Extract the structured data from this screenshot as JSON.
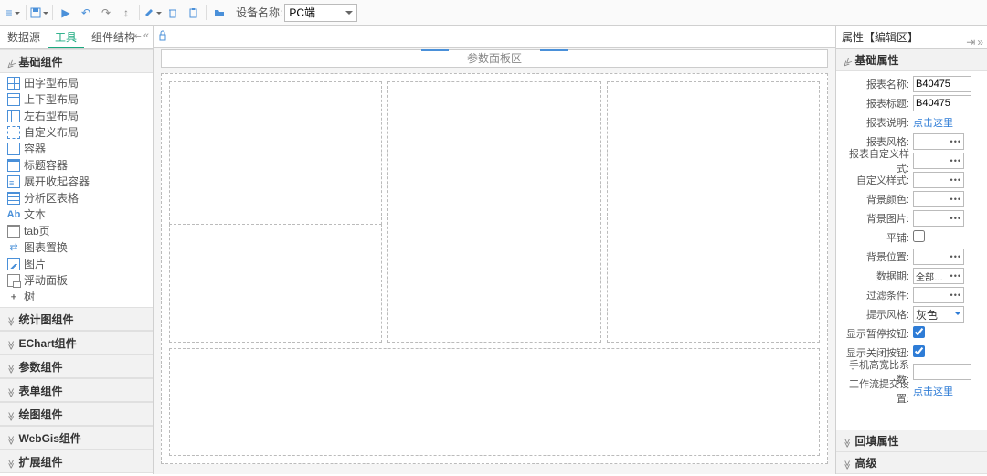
{
  "toolbar": {
    "device_label": "设备名称:",
    "device_value": "PC端"
  },
  "left": {
    "tabs": [
      "数据源",
      "工具",
      "组件结构"
    ],
    "active_tab": 1,
    "groups": [
      {
        "title": "基础组件",
        "open": true,
        "items": [
          {
            "icon": "grid",
            "label": "田字型布局"
          },
          {
            "icon": "top",
            "label": "上下型布局"
          },
          {
            "icon": "lr",
            "label": "左右型布局"
          },
          {
            "icon": "dash",
            "label": "自定义布局"
          },
          {
            "icon": "rect",
            "label": "容器"
          },
          {
            "icon": "title",
            "label": "标题容器"
          },
          {
            "icon": "expand",
            "label": "展开收起容器"
          },
          {
            "icon": "table",
            "label": "分析区表格"
          },
          {
            "icon": "ab",
            "label": "文本"
          },
          {
            "icon": "tab",
            "label": "tab页"
          },
          {
            "icon": "swap",
            "label": "图表置换"
          },
          {
            "icon": "img",
            "label": "图片"
          },
          {
            "icon": "float",
            "label": "浮动面板"
          },
          {
            "icon": "tree",
            "label": "树"
          }
        ]
      },
      {
        "title": "统计图组件",
        "open": false
      },
      {
        "title": "EChart组件",
        "open": false
      },
      {
        "title": "参数组件",
        "open": false
      },
      {
        "title": "表单组件",
        "open": false
      },
      {
        "title": "绘图组件",
        "open": false
      },
      {
        "title": "WebGis组件",
        "open": false
      },
      {
        "title": "扩展组件",
        "open": false
      }
    ]
  },
  "center": {
    "param_panel_label": "参数面板区"
  },
  "right": {
    "title": "属性【编辑区】",
    "sections": {
      "basic": "基础属性",
      "feedback": "回填属性",
      "advanced": "高级"
    },
    "props": {
      "report_name_label": "报表名称:",
      "report_name_value": "B40475",
      "report_title_label": "报表标题:",
      "report_title_value": "B40475",
      "report_desc_label": "报表说明:",
      "report_desc_link": "点击这里",
      "report_style_label": "报表风格:",
      "custom_style_label": "报表自定义样式:",
      "custom_css_label": "自定义样式:",
      "bg_color_label": "背景颜色:",
      "bg_image_label": "背景图片:",
      "tile_label": "平铺:",
      "bg_pos_label": "背景位置:",
      "data_period_label": "数据期:",
      "data_period_value": "全部数据期",
      "filter_label": "过滤条件:",
      "tip_style_label": "提示风格:",
      "tip_style_value": "灰色",
      "show_pause_label": "显示暂停按钮:",
      "show_close_label": "显示关闭按钮:",
      "aspect_label": "手机高宽比系数:",
      "workflow_label": "工作流提交设置:",
      "workflow_link": "点击这里"
    }
  }
}
